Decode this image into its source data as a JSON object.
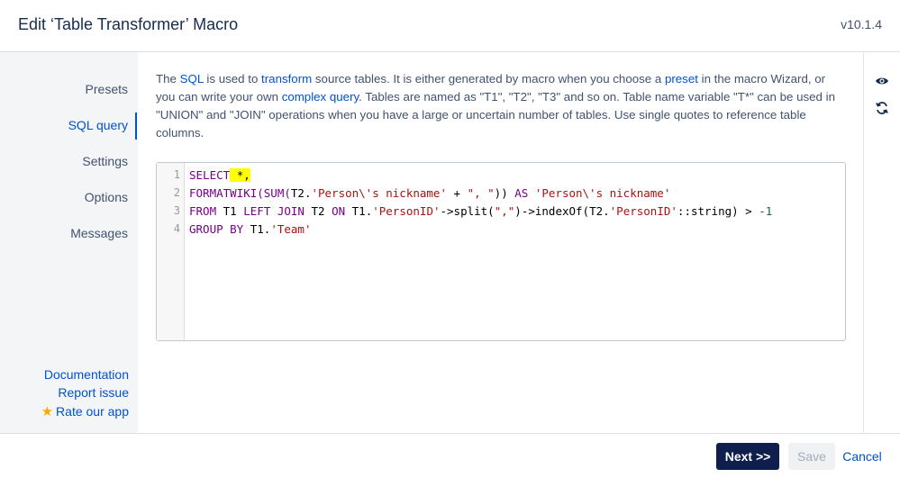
{
  "header": {
    "title": "Edit ‘Table Transformer’ Macro",
    "version": "v10.1.4"
  },
  "sidebar": {
    "items": [
      {
        "label": "Presets"
      },
      {
        "label": "SQL query"
      },
      {
        "label": "Settings"
      },
      {
        "label": "Options"
      },
      {
        "label": "Messages"
      }
    ],
    "active": "SQL query",
    "links": {
      "documentation": "Documentation",
      "report_issue": "Report issue",
      "rate_app": "Rate our app"
    }
  },
  "description": {
    "p1": "The ",
    "sql": "SQL",
    "p2": " is used to ",
    "transform": "transform",
    "p3": " source tables. It is either generated by macro when you choose a ",
    "preset": "preset",
    "p4": " in the macro Wizard, or you can write your own ",
    "complex_query": "complex query",
    "p5": ". Tables are named as \"T1\", \"T2\", \"T3\" and so on. Table name variable \"T*\" can be used in \"UNION\" and \"JOIN\" operations when you have a large or uncertain number of tables. Use single quotes to reference table columns."
  },
  "editor": {
    "line_numbers": [
      "1",
      "2",
      "3",
      "4"
    ],
    "line1": {
      "kw": "SELECT",
      "sp": " ",
      "hl": "*,"
    },
    "line2": {
      "fn1": "FORMATWIKI(SUM(",
      "t1": "T2.",
      "s1": "'Person\\'s nickname'",
      "t2": " + ",
      "s2": "\", \"",
      "t3": ")) ",
      "kw": "AS",
      "t4": " ",
      "s3": "'Person\\'s nickname'"
    },
    "line3": {
      "kw1": "FROM",
      "t1": " T1 ",
      "kw2": "LEFT JOIN",
      "t2": " T2 ",
      "kw3": "ON",
      "t3": " T1.",
      "s1": "'PersonID'",
      "t4": "->split(",
      "s2": "\",\"",
      "t5": ")->indexOf(T2.",
      "s3": "'PersonID'",
      "t6": "::string) > ",
      "n1": "-1"
    },
    "line4": {
      "kw": "GROUP BY",
      "t1": " T1.",
      "s1": "'Team'"
    }
  },
  "rail": {
    "icons": [
      "eye-icon",
      "refresh-icon"
    ]
  },
  "footer": {
    "next": "Next >>",
    "save": "Save",
    "cancel": "Cancel"
  },
  "colors": {
    "accent": "#0052cc",
    "primary_button": "#0e1f4d",
    "highlight": "#ffff00"
  }
}
